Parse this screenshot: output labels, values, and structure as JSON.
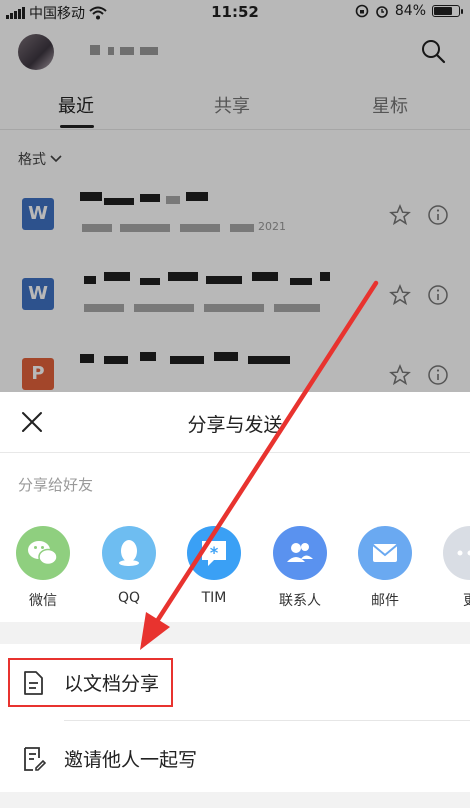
{
  "status_bar": {
    "carrier": "中国移动",
    "time": "11:52",
    "battery": "84%",
    "battery_level": 0.84
  },
  "header": {
    "avatar_icon": "user-avatar",
    "search_icon": "search-icon"
  },
  "tabs": [
    {
      "label": "最近",
      "active": true
    },
    {
      "label": "共享",
      "active": false
    },
    {
      "label": "星标",
      "active": false
    }
  ],
  "filter": {
    "label": "格式",
    "icon": "chevron-down-icon"
  },
  "files": [
    {
      "type": "word",
      "icon_label": "W",
      "icon_color": "#3f72c4",
      "partial_date": "2021"
    },
    {
      "type": "word",
      "icon_label": "W",
      "icon_color": "#3f72c4"
    },
    {
      "type": "ppt",
      "icon_label": "P",
      "icon_color": "#e2623b"
    }
  ],
  "sheet": {
    "title": "分享与发送",
    "close_icon": "close-icon",
    "share_to_friends_label": "分享给好友",
    "share_targets": [
      {
        "label": "微信",
        "icon": "wechat-icon",
        "color": "#8fcf7f"
      },
      {
        "label": "QQ",
        "icon": "qq-icon",
        "color": "#6ebdf1"
      },
      {
        "label": "TIM",
        "icon": "tim-icon",
        "color": "#3aa0f5"
      },
      {
        "label": "联系人",
        "icon": "contacts-icon",
        "color": "#5a92ef"
      },
      {
        "label": "邮件",
        "icon": "mail-icon",
        "color": "#6aa9f1"
      },
      {
        "label": "更",
        "icon": "more-icon",
        "color": "#d9dde4"
      }
    ],
    "actions": [
      {
        "label": "以文档分享",
        "icon": "document-icon"
      },
      {
        "label": "邀请他人一起写",
        "icon": "edit-document-icon"
      }
    ]
  },
  "annotation": {
    "color": "#e8332f",
    "highlighted_action": "以文档分享"
  }
}
